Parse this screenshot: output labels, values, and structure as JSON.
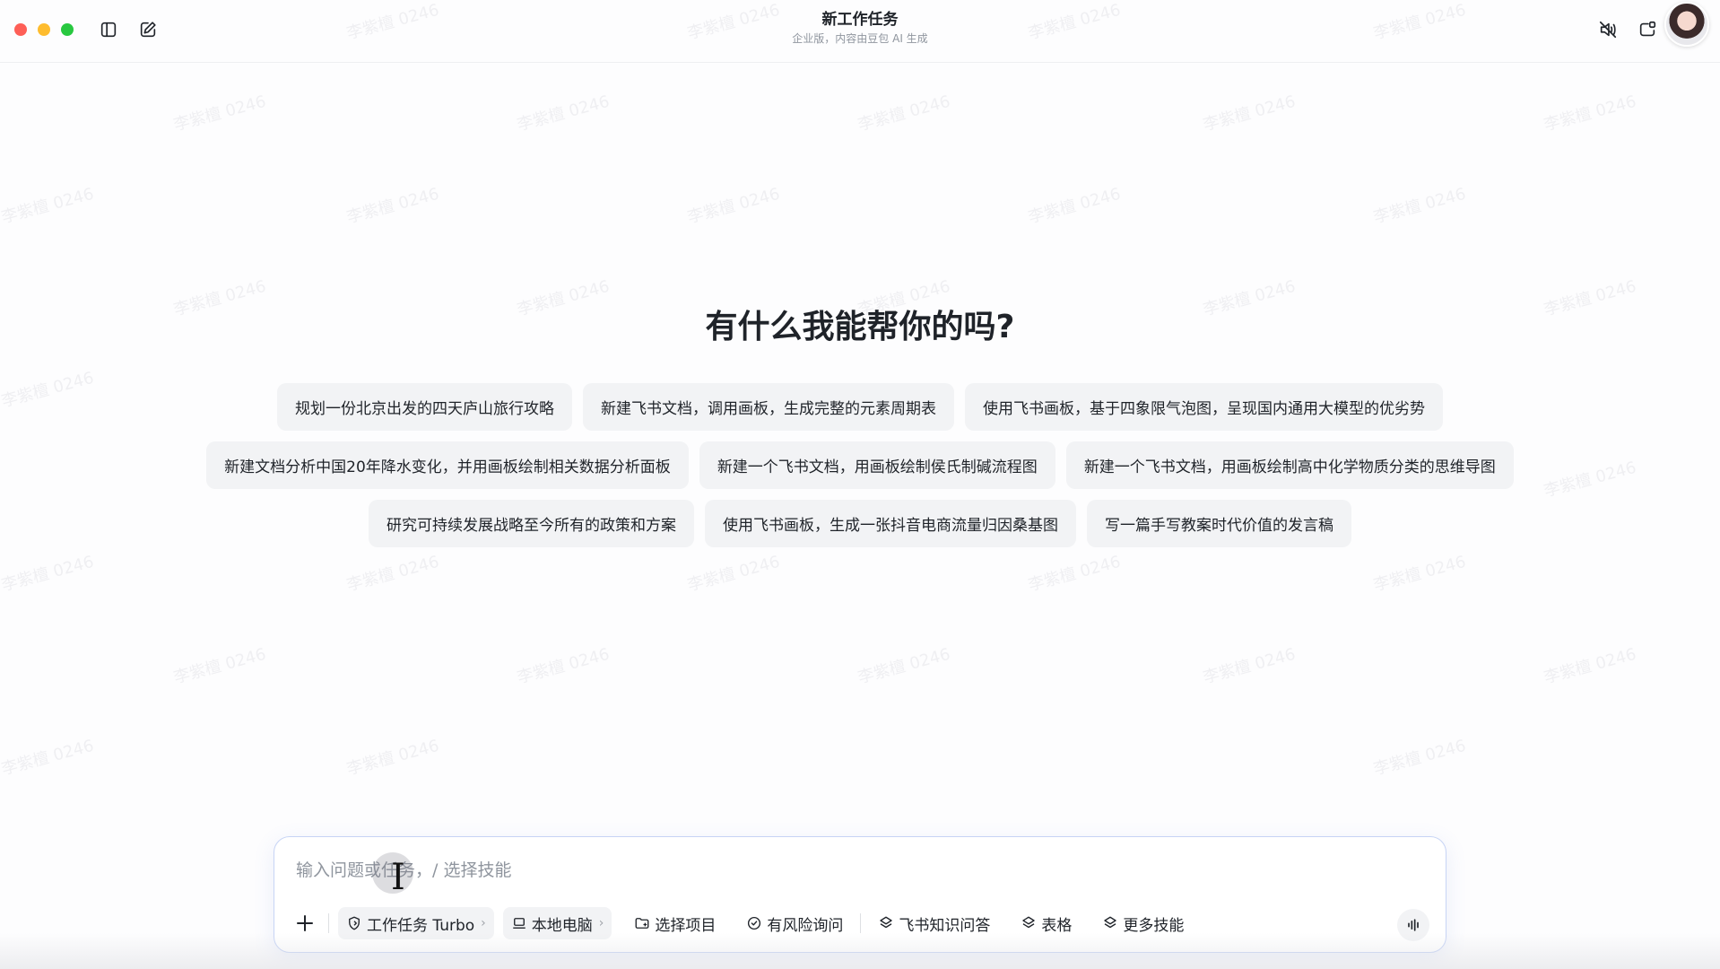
{
  "titlebar": {
    "title": "新工作任务",
    "subtitle": "企业版，内容由豆包 AI 生成"
  },
  "watermark_text": "李紫檀 0246",
  "hero": {
    "heading": "有什么我能帮你的吗?"
  },
  "suggestions": [
    [
      "规划一份北京出发的四天庐山旅行攻略",
      "新建飞书文档，调用画板，生成完整的元素周期表",
      "使用飞书画板，基于四象限气泡图，呈现国内通用大模型的优劣势"
    ],
    [
      "新建文档分析中国20年降水变化，并用画板绘制相关数据分析面板",
      "新建一个飞书文档，用画板绘制侯氏制碱流程图",
      "新建一个飞书文档，用画板绘制高中化学物质分类的思维导图"
    ],
    [
      "研究可持续发展战略至今所有的政策和方案",
      "使用飞书画板，生成一张抖音电商流量归因桑基图",
      "写一篇手写教案时代价值的发言稿"
    ]
  ],
  "input": {
    "placeholder": "输入问题或任务，/ 选择技能",
    "value": ""
  },
  "toolbar": {
    "work_task": "工作任务 Turbo",
    "local_pc": "本地电脑",
    "select_project": "选择项目",
    "risk_inquiry": "有风险询问",
    "feishu_qa": "飞书知识问答",
    "table": "表格",
    "more_skills": "更多技能"
  }
}
